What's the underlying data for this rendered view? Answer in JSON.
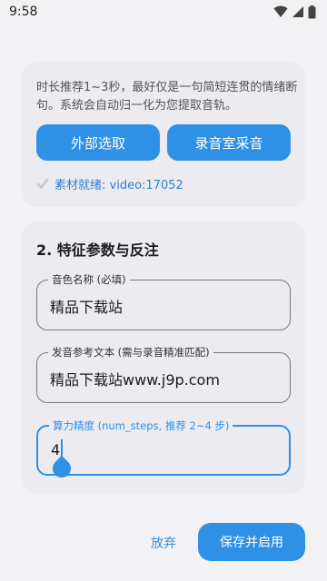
{
  "status_bar": {
    "time": "9:58",
    "icons": [
      "wifi-icon",
      "cellular-signal-icon",
      "battery-icon"
    ]
  },
  "source_section": {
    "description": "时长推荐1~3秒，最好仅是一句简短连贯的情绪断句。系统会自动归一化为您提取音轨。",
    "pick_button": "外部选取",
    "record_button": "录音室采音",
    "ready_icon": "check-icon",
    "ready_text": "素材就绪: video:17052"
  },
  "params_section": {
    "title": "2. 特征参数与反注",
    "voice_name": {
      "label": "音色名称 (必填)",
      "value": "精品下载站"
    },
    "reference_text": {
      "label": "发音参考文本 (需与录音精准匹配)",
      "value": "精品下载站www.j9p.com"
    },
    "num_steps": {
      "label": "算力精度 (num_steps, 推荐 2~4 步)",
      "value": "4"
    }
  },
  "actions": {
    "cancel": "放弃",
    "save": "保存并启用"
  },
  "colors": {
    "accent": "#2f91e6",
    "background": "#f2f2f4",
    "card": "#ebebf0"
  }
}
